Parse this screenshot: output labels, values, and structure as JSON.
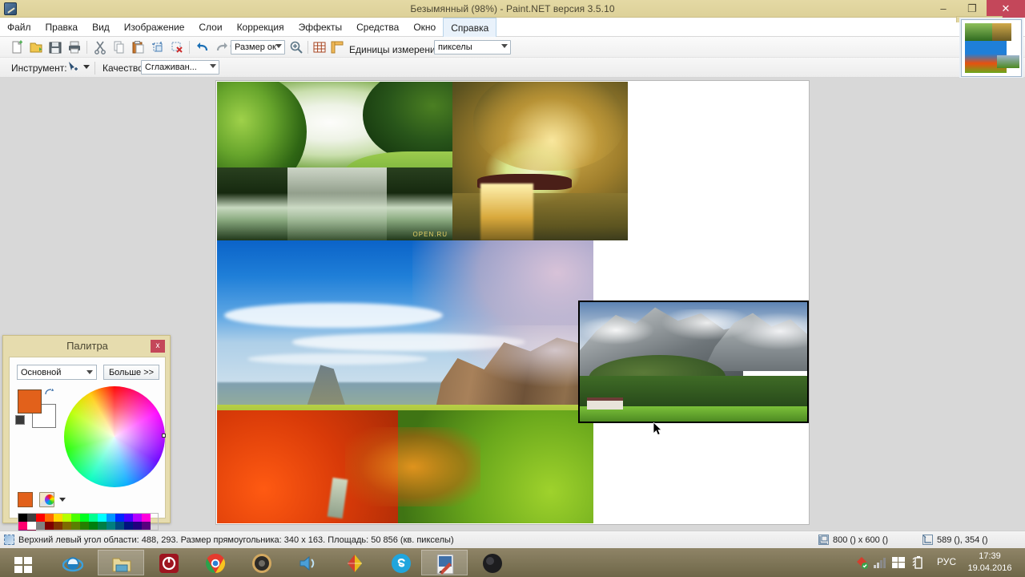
{
  "window": {
    "title": "Безымянный (98%) - Paint.NET версия 3.5.10",
    "app_icon": "paintnet-icon",
    "minimize": "–",
    "maximize": "❐",
    "close": "✕"
  },
  "menu": {
    "items": [
      {
        "label": "Файл",
        "name": "menu-file"
      },
      {
        "label": "Правка",
        "name": "menu-edit"
      },
      {
        "label": "Вид",
        "name": "menu-view"
      },
      {
        "label": "Изображение",
        "name": "menu-image"
      },
      {
        "label": "Слои",
        "name": "menu-layers"
      },
      {
        "label": "Коррекция",
        "name": "menu-adjustments"
      },
      {
        "label": "Эффекты",
        "name": "menu-effects"
      },
      {
        "label": "Средства",
        "name": "menu-tools"
      },
      {
        "label": "Окно",
        "name": "menu-window"
      },
      {
        "label": "Справка",
        "name": "menu-help"
      }
    ]
  },
  "toolbar": {
    "icons": [
      {
        "name": "new-icon",
        "title": "Создать"
      },
      {
        "name": "open-icon",
        "title": "Открыть"
      },
      {
        "name": "save-icon",
        "title": "Сохранить"
      },
      {
        "name": "print-icon",
        "title": "Печать"
      },
      {
        "name": "cut-icon",
        "title": "Вырезать"
      },
      {
        "name": "copy-icon",
        "title": "Копировать"
      },
      {
        "name": "paste-icon",
        "title": "Вставить"
      },
      {
        "name": "crop-icon",
        "title": "Обрезать"
      },
      {
        "name": "deselect-icon",
        "title": "Отменить выделение"
      },
      {
        "name": "undo-icon",
        "title": "Отменить"
      },
      {
        "name": "redo-icon",
        "title": "Вернуть"
      },
      {
        "name": "zoom-out-icon",
        "title": "Уменьшить"
      }
    ],
    "zoom_combo_value": "Размер ок",
    "zoom_in_icon": "zoom-in-icon",
    "grid_icon": "grid-icon",
    "rulers_icon": "rulers-icon",
    "units_label": "Единицы измерения:",
    "units_value": "пикселы"
  },
  "toolbar2": {
    "tool_label": "Инструмент:",
    "tool_icon": "magic-wand-icon",
    "quality_label": "Качество:",
    "quality_value": "Сглаживан..."
  },
  "palette": {
    "title": "Палитра",
    "close": "x",
    "mode_value": "Основной",
    "more_label": "Больше >>",
    "primary_color": "#e2611b",
    "secondary_color": "#ffffff",
    "swap_icon": "swap-colors-icon",
    "reset_icon": "reset-colors-icon",
    "add_color_icon": "add-color-icon",
    "palette_icon": "palette-chooser-icon",
    "swatches": [
      "#000000",
      "#404040",
      "#ff0000",
      "#ff6a00",
      "#ffd800",
      "#b6ff00",
      "#4cff00",
      "#00ff21",
      "#00ff90",
      "#00ffff",
      "#0094ff",
      "#0026ff",
      "#4800ff",
      "#b200ff",
      "#ff00dc",
      "#ff006e",
      "#ffffff",
      "#808080",
      "#7f0000",
      "#7f3300",
      "#7f6a00",
      "#5b7f00",
      "#267f00",
      "#007f0e",
      "#007f46",
      "#007f7f",
      "#004a7f",
      "#00137f",
      "#21007f",
      "#57007f",
      "#7f006e",
      "#7f0037"
    ]
  },
  "status": {
    "selection_icon": "selection-icon",
    "text": "Верхний левый угол области: 488, 293. Размер прямоугольника: 340 x 163. Площадь: 50 856 (кв. пикселы)",
    "size_icon": "image-size-icon",
    "size": "800 () x 600 ()",
    "position_icon": "cursor-position-icon",
    "position": "589 (), 354 ()"
  },
  "canvas": {
    "images": [
      {
        "name": "photo-forest-river",
        "desc": "Зелёный лес с рекой",
        "watermark": "OPEN.RU"
      },
      {
        "name": "photo-wave-sunset",
        "desc": "Золотая волна на закате"
      },
      {
        "name": "photo-autumn-canyon",
        "desc": "Осенний каньон с синим небом"
      },
      {
        "name": "photo-alpine-mountains",
        "desc": "Горы в облаках, выделенный слой"
      }
    ],
    "cursor": "mouse-pointer"
  },
  "thumbnail_panel": {
    "name": "image-thumbnail-panel"
  },
  "taskbar": {
    "start": "start-button",
    "items": [
      {
        "name": "taskbar-internet-explorer",
        "label": "Internet Explorer"
      },
      {
        "name": "taskbar-file-explorer",
        "label": "Проводник"
      },
      {
        "name": "taskbar-power-app",
        "label": "Power"
      },
      {
        "name": "taskbar-chrome",
        "label": "Google Chrome"
      },
      {
        "name": "taskbar-media-player",
        "label": "Медиаплеер"
      },
      {
        "name": "taskbar-volume-app",
        "label": "Звук"
      },
      {
        "name": "taskbar-kaspersky",
        "label": "Kaspersky"
      },
      {
        "name": "taskbar-skype",
        "label": "Skype"
      },
      {
        "name": "taskbar-paintnet",
        "label": "Paint.NET"
      },
      {
        "name": "taskbar-obs",
        "label": "OBS"
      }
    ],
    "tray": {
      "language": "РУС",
      "time": "17:39",
      "date": "19.04.2016"
    }
  }
}
